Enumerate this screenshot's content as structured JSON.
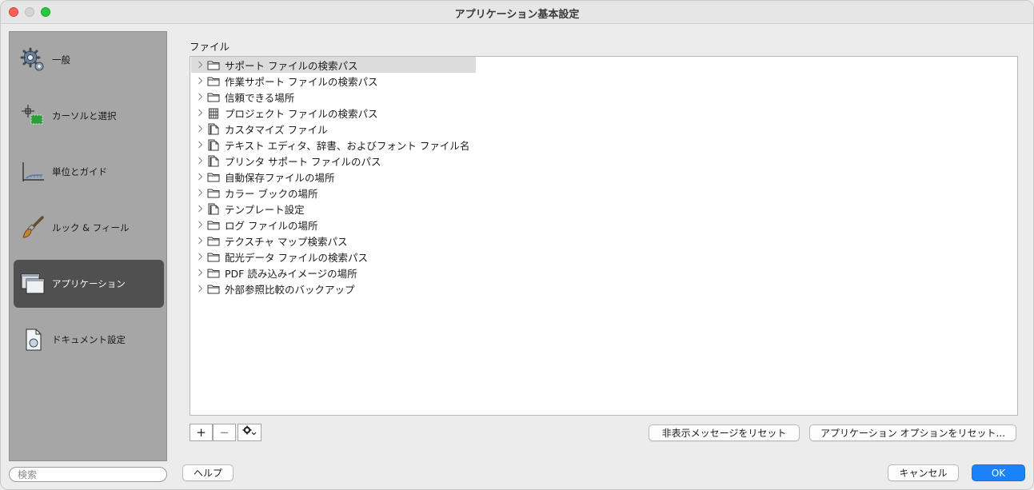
{
  "window": {
    "title": "アプリケーション基本設定"
  },
  "sidebar": {
    "items": [
      {
        "label": "一般",
        "icon": "gear-icon",
        "active": false
      },
      {
        "label": "カーソルと選択",
        "icon": "cursor-select-icon",
        "active": false
      },
      {
        "label": "単位とガイド",
        "icon": "ruler-guide-icon",
        "active": false
      },
      {
        "label": "ルック & フィール",
        "icon": "paintbrush-icon",
        "active": false
      },
      {
        "label": "アプリケーション",
        "icon": "windows-icon",
        "active": true
      },
      {
        "label": "ドキュメント設定",
        "icon": "document-icon",
        "active": false
      }
    ],
    "search_placeholder": "検索"
  },
  "main": {
    "section_label": "ファイル",
    "rows": [
      {
        "label": "サポート ファイルの検索パス",
        "icon": "folder-icon",
        "selected": true
      },
      {
        "label": "作業サポート ファイルの検索パス",
        "icon": "folder-icon",
        "selected": false
      },
      {
        "label": "信頼できる場所",
        "icon": "folder-icon",
        "selected": false
      },
      {
        "label": "プロジェクト ファイルの検索パス",
        "icon": "project-file-icon",
        "selected": false
      },
      {
        "label": "カスタマイズ ファイル",
        "icon": "file-stack-icon",
        "selected": false
      },
      {
        "label": "テキスト エディタ、辞書、およびフォント ファイル名",
        "icon": "file-stack-icon",
        "selected": false
      },
      {
        "label": "プリンタ サポート ファイルのパス",
        "icon": "file-stack-icon",
        "selected": false
      },
      {
        "label": "自動保存ファイルの場所",
        "icon": "folder-icon",
        "selected": false
      },
      {
        "label": "カラー ブックの場所",
        "icon": "folder-icon",
        "selected": false
      },
      {
        "label": "テンプレート設定",
        "icon": "file-stack-icon",
        "selected": false
      },
      {
        "label": "ログ ファイルの場所",
        "icon": "folder-icon",
        "selected": false
      },
      {
        "label": "テクスチャ マップ検索パス",
        "icon": "folder-icon",
        "selected": false
      },
      {
        "label": "配光データ ファイルの検索パス",
        "icon": "folder-icon",
        "selected": false
      },
      {
        "label": "PDF 読み込みイメージの場所",
        "icon": "folder-icon",
        "selected": false
      },
      {
        "label": "外部参照比較のバックアップ",
        "icon": "folder-icon",
        "selected": false
      }
    ]
  },
  "toolbar": {
    "add": "+",
    "remove": "−"
  },
  "buttons": {
    "reset_hidden": "非表示メッセージをリセット",
    "reset_options": "アプリケーション オプションをリセット...",
    "help": "ヘルプ",
    "cancel": "キャンセル",
    "ok": "OK"
  },
  "colors": {
    "accent": "#1a82fb",
    "sidebar_bg": "#a6a6a6",
    "sidebar_active": "#505050"
  }
}
